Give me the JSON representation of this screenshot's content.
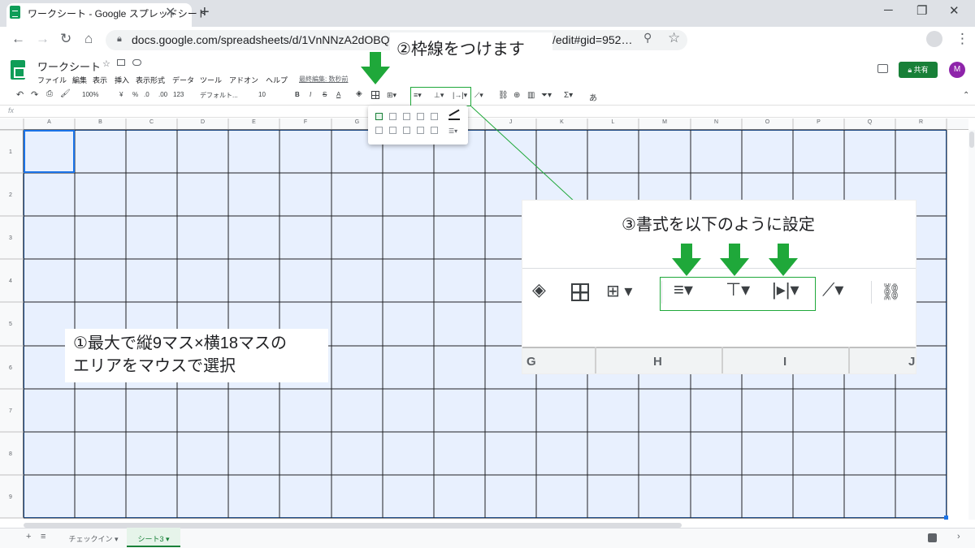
{
  "browser": {
    "tab_title": "ワークシート - Google スプレッドシート",
    "tab_close": "✕",
    "new_tab": "+",
    "url": "docs.google.com/spreadsheets/d/1VnNNzA2dOBQvwh",
    "url_tail": "/edit#gid=952…",
    "window_minimize": "─",
    "window_restore": "❐",
    "window_close": "✕"
  },
  "app": {
    "title": "ワークシート",
    "menus": [
      "ファイル",
      "編集",
      "表示",
      "挿入",
      "表示形式",
      "データ",
      "ツール",
      "アドオン",
      "ヘルプ"
    ],
    "last_edit": "最終編集: 数秒前",
    "share_label": "共有",
    "avatar_letter": "M"
  },
  "toolbar": {
    "zoom": "100%",
    "currency": "¥",
    "percent": "%",
    "dec_less": ".0",
    "dec_more": ".00",
    "format_123": "123",
    "font": "デフォルト...",
    "font_size": "10",
    "bold": "B",
    "italic": "I",
    "strike": "S",
    "text_color": "A",
    "input_tool": "あ"
  },
  "formula_bar": {
    "fx": "fx"
  },
  "columns": [
    "A",
    "B",
    "C",
    "D",
    "E",
    "F",
    "G",
    "H",
    "I",
    "J",
    "K",
    "L",
    "M",
    "N",
    "O",
    "P",
    "Q",
    "R"
  ],
  "rows": [
    "1",
    "2",
    "3",
    "4",
    "5",
    "6",
    "7",
    "8",
    "9"
  ],
  "sheets": {
    "sheet1": "チェックイン",
    "sheet2": "シート3"
  },
  "annotations": {
    "step1_line1": "①最大で縦9マス×横18マスの",
    "step1_line2": "エリアをマウスで選択",
    "step2": "②枠線をつけます",
    "step3": "③書式を以下のように設定"
  },
  "zoom_panel": {
    "columns": [
      "G",
      "H",
      "I",
      "J"
    ]
  },
  "colors": {
    "selection_fill": "#e8f0fe",
    "selection_border": "#1a73e8",
    "arrow_green": "#1fa83a",
    "share_green": "#188038",
    "avatar_purple": "#8e24aa"
  }
}
